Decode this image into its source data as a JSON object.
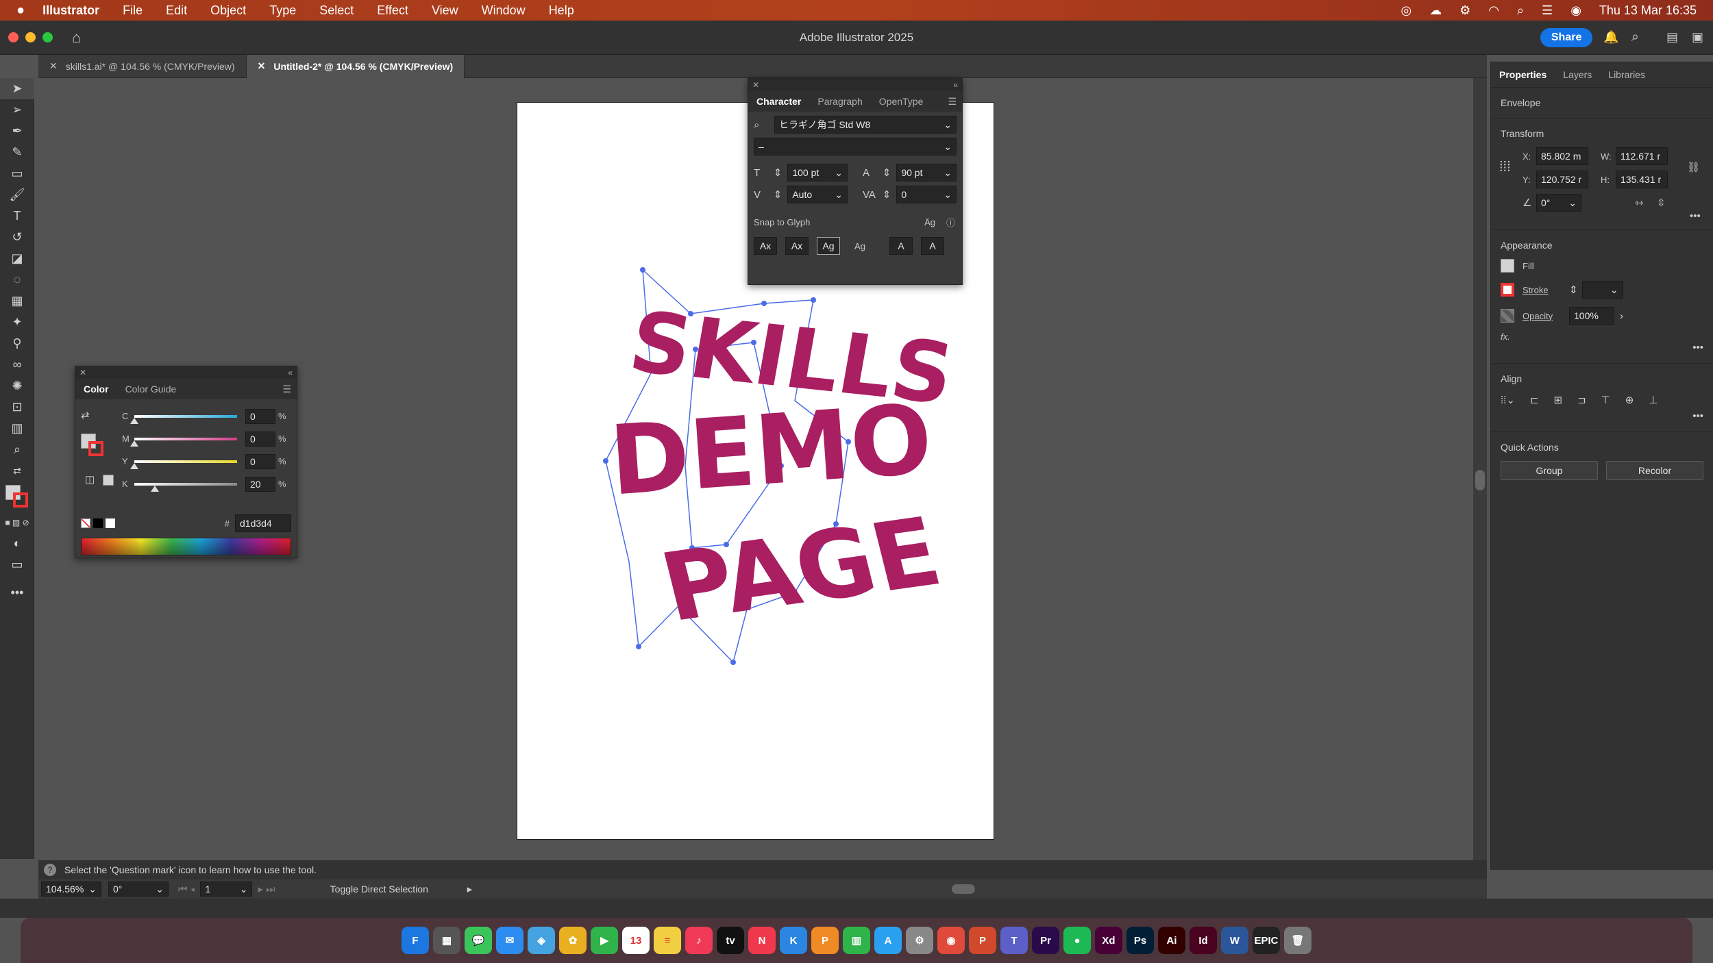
{
  "menubar": {
    "apple": "",
    "app_name": "Illustrator",
    "items": [
      "File",
      "Edit",
      "Object",
      "Type",
      "Select",
      "Effect",
      "View",
      "Window",
      "Help"
    ],
    "clock": "Thu 13 Mar  16:35"
  },
  "window": {
    "title": "Adobe Illustrator 2025",
    "share_label": "Share"
  },
  "doc_tabs": [
    {
      "label": "skills1.ai* @ 104.56 % (CMYK/Preview)"
    },
    {
      "label": "Untitled-2* @ 104.56 % (CMYK/Preview)"
    }
  ],
  "character_panel": {
    "tabs": [
      "Character",
      "Paragraph",
      "OpenType"
    ],
    "font_family": "ヒラギノ角ゴ Std W8",
    "font_style": "–",
    "size": "100 pt",
    "leading": "90 pt",
    "kerning": "Auto",
    "tracking": "0",
    "snap_label": "Snap to Glyph"
  },
  "color_panel": {
    "tabs": [
      "Color",
      "Color Guide"
    ],
    "channels": [
      {
        "label": "C",
        "value": "0",
        "unit": "%",
        "color": "#2aa7d6",
        "level": 0
      },
      {
        "label": "M",
        "value": "0",
        "unit": "%",
        "color": "#d23c8c",
        "level": 0
      },
      {
        "label": "Y",
        "value": "0",
        "unit": "%",
        "color": "#e6d728",
        "level": 0
      },
      {
        "label": "K",
        "value": "20",
        "unit": "%",
        "color": "#8a8a8a",
        "level": 0.2
      }
    ],
    "hex_label": "#",
    "hex_value": "d1d3d4"
  },
  "artwork": {
    "lines": [
      "SKILLS",
      "DEMO",
      "PAGE"
    ],
    "fill_color": "#a91f62"
  },
  "properties": {
    "tabs": [
      "Properties",
      "Layers",
      "Libraries"
    ],
    "envelope": "Envelope",
    "transform_title": "Transform",
    "x_label": "X:",
    "x": "85.802 m",
    "y_label": "Y:",
    "y": "120.752 r",
    "w_label": "W:",
    "w": "112.671 r",
    "h_label": "H:",
    "h": "135.431 r",
    "angle": "0°",
    "appearance_title": "Appearance",
    "fill_label": "Fill",
    "stroke_label": "Stroke",
    "opacity_label": "Opacity",
    "opacity_value": "100%",
    "fx_label": "fx.",
    "align_title": "Align",
    "quick_actions_title": "Quick Actions",
    "group_label": "Group",
    "recolor_label": "Recolor"
  },
  "helpbar": {
    "text": "Select the 'Question mark' icon to learn how to use the tool."
  },
  "statusbar": {
    "zoom": "104.56%",
    "rotation": "0°",
    "artboard_num": "1",
    "tool_status": "Toggle Direct Selection"
  },
  "dock": {
    "items": [
      {
        "name": "finder",
        "label": "F",
        "color": "#1d77e0"
      },
      {
        "name": "launchpad",
        "label": "▦",
        "color": "#555"
      },
      {
        "name": "messages",
        "label": "💬",
        "color": "#3bc45a"
      },
      {
        "name": "mail",
        "label": "✉",
        "color": "#2d8cf0"
      },
      {
        "name": "maps",
        "label": "◈",
        "color": "#44a3e0"
      },
      {
        "name": "photos",
        "label": "✿",
        "color": "#e8b020"
      },
      {
        "name": "facetime",
        "label": "▶",
        "color": "#2fb34a"
      },
      {
        "name": "calendar",
        "label": "13",
        "color": "#ffffff"
      },
      {
        "name": "notes",
        "label": "≡",
        "color": "#f1cf40"
      },
      {
        "name": "music",
        "label": "♪",
        "color": "#f03a55"
      },
      {
        "name": "tv",
        "label": "tv",
        "color": "#111"
      },
      {
        "name": "news",
        "label": "N",
        "color": "#f0384c"
      },
      {
        "name": "keynote",
        "label": "K",
        "color": "#2a86e0"
      },
      {
        "name": "pages",
        "label": "P",
        "color": "#f08a24"
      },
      {
        "name": "numbers",
        "label": "▥",
        "color": "#2fb44a"
      },
      {
        "name": "appstore",
        "label": "A",
        "color": "#2aa0f0"
      },
      {
        "name": "settings",
        "label": "⚙",
        "color": "#888"
      },
      {
        "name": "chrome",
        "label": "◉",
        "color": "#e04a3a"
      },
      {
        "name": "powerpoint",
        "label": "P",
        "color": "#d0492a"
      },
      {
        "name": "teams",
        "label": "T",
        "color": "#5b5fc7"
      },
      {
        "name": "premiere",
        "label": "Pr",
        "color": "#2a0a4a"
      },
      {
        "name": "spotify",
        "label": "●",
        "color": "#1db954"
      },
      {
        "name": "xd",
        "label": "Xd",
        "color": "#470137"
      },
      {
        "name": "photoshop",
        "label": "Ps",
        "color": "#001e36"
      },
      {
        "name": "illustrator",
        "label": "Ai",
        "color": "#330000"
      },
      {
        "name": "indesign",
        "label": "Id",
        "color": "#49021f"
      },
      {
        "name": "word",
        "label": "W",
        "color": "#2b579a"
      },
      {
        "name": "epic",
        "label": "EPIC",
        "color": "#222"
      },
      {
        "name": "trash",
        "label": "🗑",
        "color": "#777"
      }
    ]
  }
}
